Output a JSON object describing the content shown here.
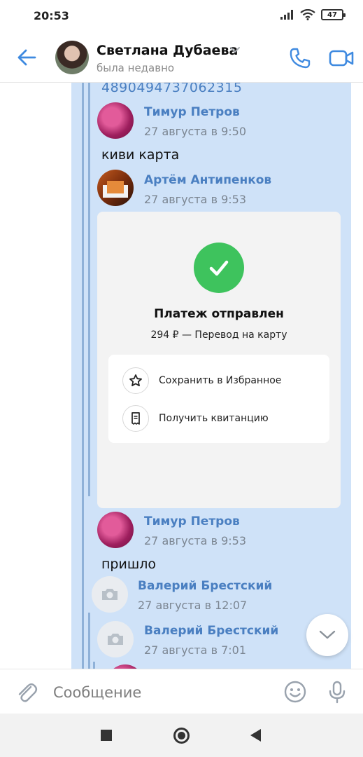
{
  "status_bar": {
    "time": "20:53",
    "battery": "47",
    "icons": [
      "signal-icon",
      "wifi-icon",
      "battery-icon"
    ]
  },
  "header": {
    "contact_name": "Светлана Дубаева",
    "contact_status": "была недавно",
    "accent_color": "#3f8ae0"
  },
  "chat": {
    "cut_text": "4890494737062315",
    "messages": [
      {
        "sender": "Тимур Петров",
        "time": "27 августа в 9:50",
        "text": "киви карта"
      },
      {
        "sender": "Артём Антипенков",
        "time": "27 августа в 9:53"
      },
      {
        "sender": "Тимур Петров",
        "time": "27 августа в 9:53",
        "text": "пришло"
      },
      {
        "sender": "Валерий Брестский",
        "time": "27 августа в 12:07"
      },
      {
        "sender": "Валерий Брестский",
        "time": "27 августа в 7:01"
      }
    ],
    "receipt": {
      "title": "Платеж отправлен",
      "subtitle": "294 ₽ — Перевод на карту",
      "actions": [
        "Сохранить в Избранное",
        "Получить квитанцию"
      ],
      "check_color": "#3ec35d"
    }
  },
  "composer": {
    "placeholder": "Сообщение"
  },
  "colors": {
    "forward_background": "#cfe2f8",
    "sender_name": "#4a7fc1"
  }
}
